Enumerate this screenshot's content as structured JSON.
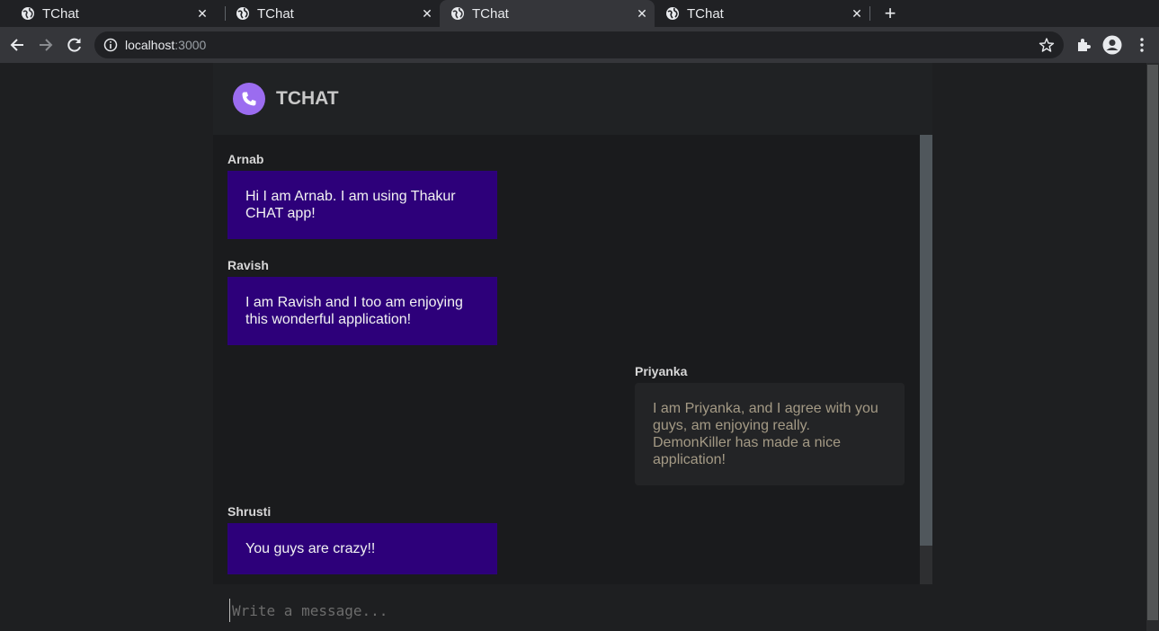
{
  "browser": {
    "tabs": [
      {
        "title": "TChat",
        "active": false
      },
      {
        "title": "TChat",
        "active": false
      },
      {
        "title": "TChat",
        "active": true
      },
      {
        "title": "TChat",
        "active": false
      }
    ],
    "url_host": "localhost",
    "url_port": ":3000"
  },
  "app": {
    "title": "TCHAT",
    "accent_color": "#9b6cf0",
    "messages": [
      {
        "sender": "Arnab",
        "text": "Hi I am Arnab. I am using Thakur CHAT app!",
        "side": "left"
      },
      {
        "sender": "Ravish",
        "text": "I am Ravish and I too am enjoying this wonderful application!",
        "side": "left"
      },
      {
        "sender": "Priyanka",
        "text": "I am Priyanka, and I agree with you guys, am enjoying really. DemonKiller has made a nice application!",
        "side": "right"
      },
      {
        "sender": "Shrusti",
        "text": "You guys are crazy!!",
        "side": "left"
      }
    ],
    "composer": {
      "placeholder": "Write a message...",
      "value": ""
    }
  },
  "colors": {
    "bubble_self": "#2d007a",
    "bubble_other": "#232426"
  }
}
